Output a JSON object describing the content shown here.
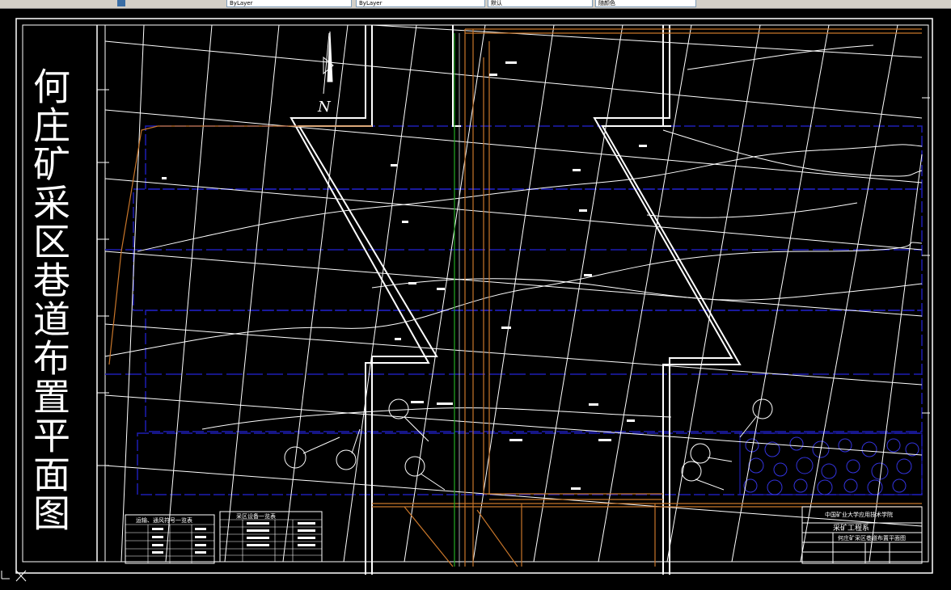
{
  "toolbar": {
    "fields": [
      "ByLayer",
      "ByLayer",
      "ByLayer",
      "默认",
      "随颜色"
    ]
  },
  "drawing": {
    "title": "何庄矿采区巷道布置平面图",
    "north_label": "N",
    "legend1_title": "运输、通风符号一览表",
    "legend2_title": "采区设备一览表",
    "titleblock": {
      "school": "中国矿业大学应用技术学院",
      "dept": "采矿工程系",
      "drawing_name": "何庄矿采区巷道布置平面图"
    }
  },
  "colors": {
    "background": "#000000",
    "white_lines": "#ffffff",
    "blue_panels": "#1e1eb4",
    "orange_roadway": "#c8762a",
    "green_line": "#22aa22"
  }
}
